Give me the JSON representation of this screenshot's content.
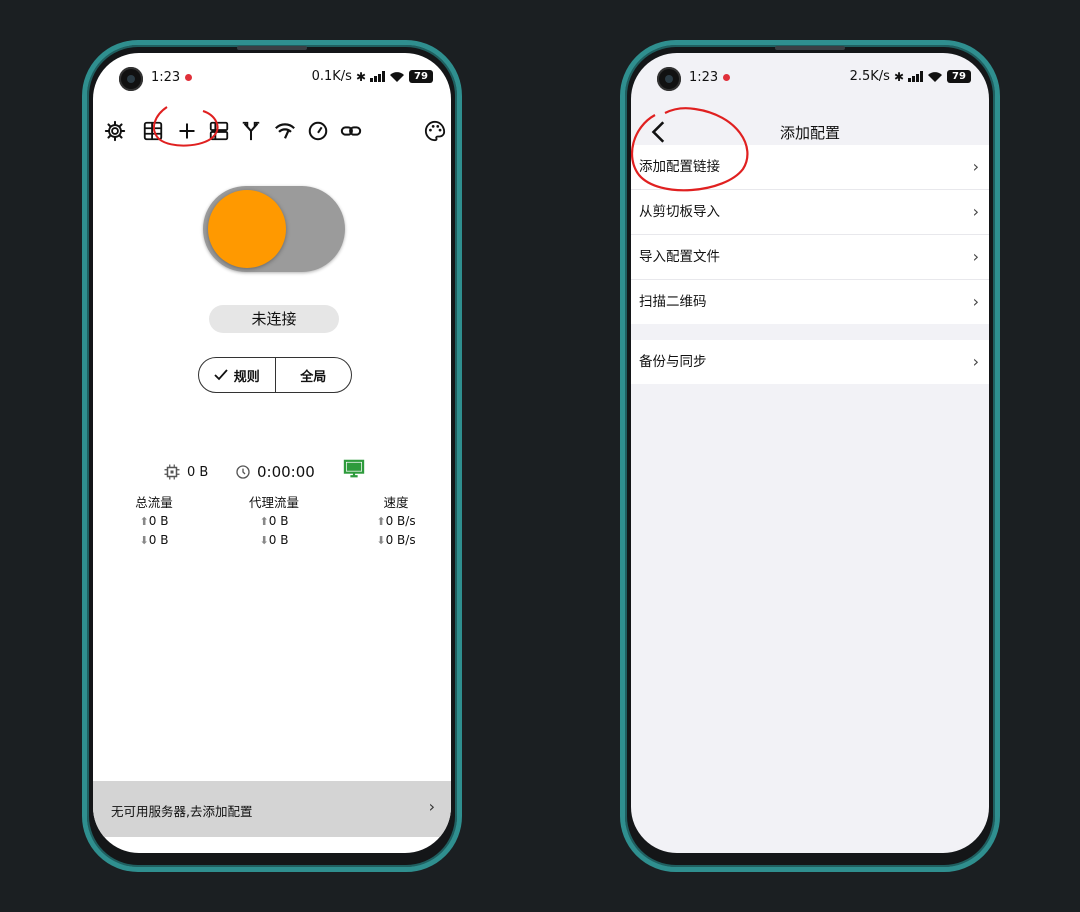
{
  "left_phone": {
    "status": {
      "time": "1:23",
      "net_speed": "0.1K/s",
      "battery": "79"
    },
    "toolbar": {
      "icons": [
        "gear-icon",
        "list-icon",
        "plus-icon",
        "servers-icon",
        "fork-icon",
        "signal-icon",
        "speedometer-icon",
        "link-icon",
        "palette-icon"
      ]
    },
    "connection_status": "未连接",
    "mode": {
      "rule_label": "规则",
      "global_label": "全局",
      "selected": "rule"
    },
    "stats": {
      "memory": "0 B",
      "duration": "0:00:00"
    },
    "traffic": {
      "total": {
        "title": "总流量",
        "up": "0 B",
        "down": "0 B"
      },
      "proxy": {
        "title": "代理流量",
        "up": "0 B",
        "down": "0 B"
      },
      "speed": {
        "title": "速度",
        "up": "0 B/s",
        "down": "0 B/s"
      }
    },
    "footer": {
      "text": "无可用服务器,去添加配置"
    }
  },
  "right_phone": {
    "status": {
      "time": "1:23",
      "net_speed": "2.5K/s",
      "battery": "79"
    },
    "title": "添加配置",
    "menu_group_1": [
      "添加配置链接",
      "从剪切板导入",
      "导入配置文件",
      "扫描二维码"
    ],
    "menu_group_2": [
      "备份与同步"
    ]
  },
  "colors": {
    "accent": "#ff9900",
    "annotation": "#e02020",
    "bezel": "#2f8f8f",
    "monitor": "#2e9b3c"
  }
}
